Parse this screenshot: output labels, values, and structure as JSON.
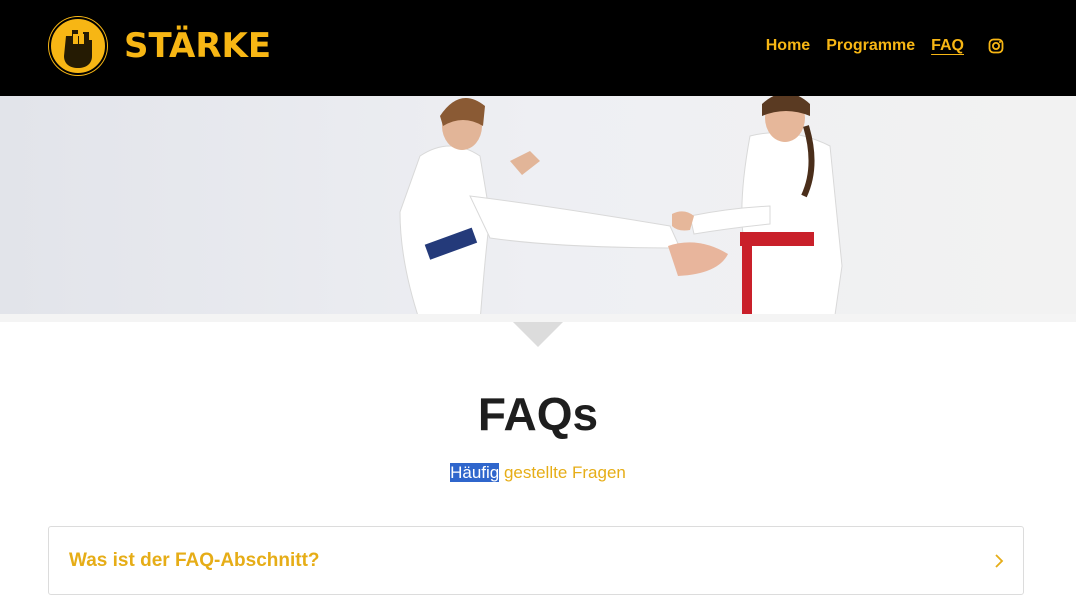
{
  "header": {
    "brand": "STÄRKE",
    "nav": [
      {
        "label": "Home",
        "active": false
      },
      {
        "label": "Programme",
        "active": false
      },
      {
        "label": "FAQ",
        "active": true
      }
    ],
    "social_icon": "instagram-icon",
    "logo_icon": "fist-icon"
  },
  "hero": {
    "image": "two women in white karate uniforms practicing a kick, blue belt and red belt"
  },
  "faq": {
    "title": "FAQs",
    "subtitle_selected": "Häufig",
    "subtitle_rest": " gestellte Fragen",
    "items": [
      {
        "question": "Was ist der FAQ-Abschnitt?",
        "icon": "chevron-right-icon"
      }
    ]
  },
  "colors": {
    "accent": "#f7b614",
    "header_bg": "#000000",
    "text_dark": "#1e1e1e",
    "selection": "#2f66cc"
  }
}
